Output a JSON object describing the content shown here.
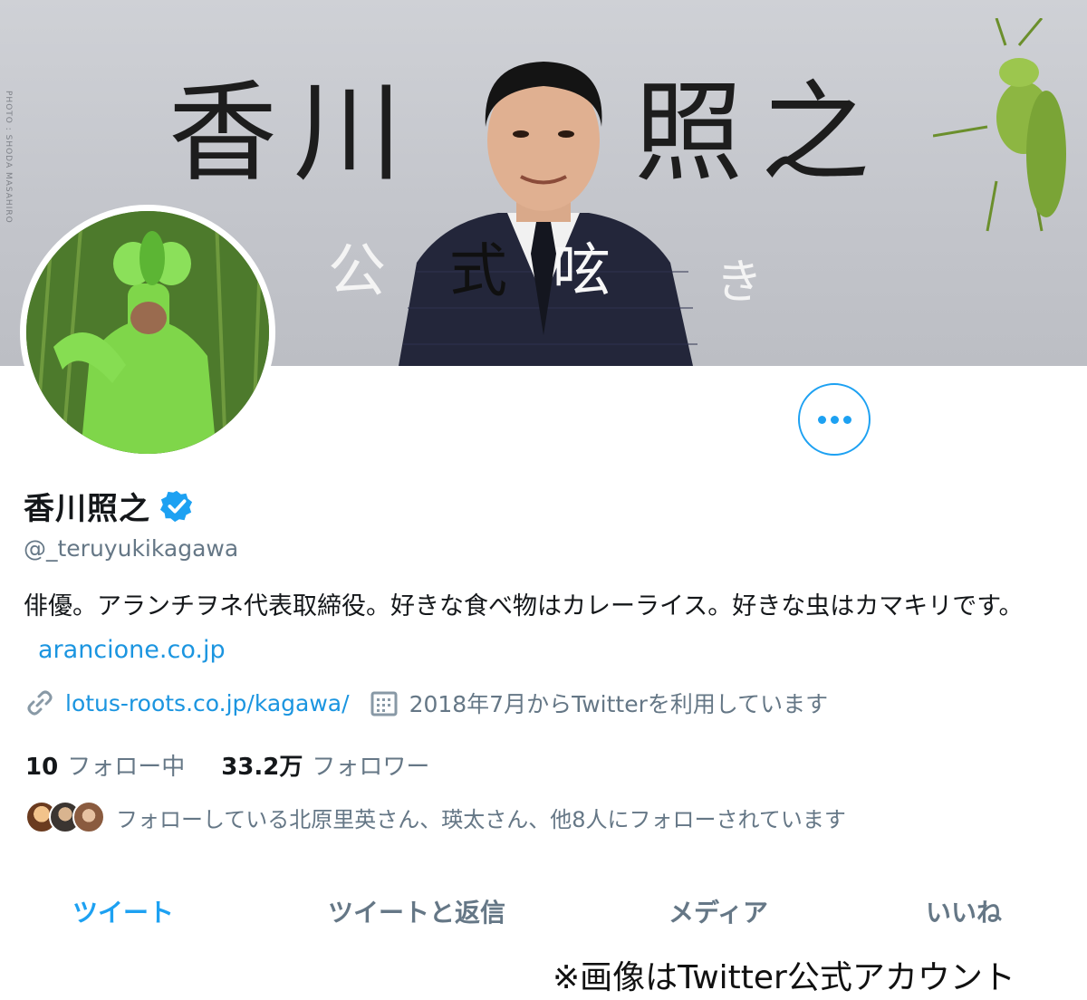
{
  "banner": {
    "photo_credit": "PHOTO : SHODA MASAHIRO",
    "title_left": "香川",
    "title_right": "照之",
    "subtitle": [
      "公",
      "式",
      "呟",
      "き"
    ]
  },
  "profile": {
    "display_name": "香川照之",
    "verified": true,
    "handle": "@_teruyukikagawa",
    "bio_text": "俳優。アランチヲネ代表取締役。好きな食べ物はカレーライス。好きな虫はカマキリです。",
    "bio_link": "arancione.co.jp",
    "website": "lotus-roots.co.jp/kagawa/",
    "joined": "2018年7月からTwitterを利用しています",
    "following_count": "10",
    "following_label": "フォロー中",
    "followers_count": "33.2万",
    "followers_label": "フォロワー",
    "followers_you_know": "フォローしている北原里英さん、瑛太さん、他8人にフォローされています"
  },
  "tabs": [
    {
      "label": "ツイート",
      "active": true
    },
    {
      "label": "ツイートと返信",
      "active": false
    },
    {
      "label": "メディア",
      "active": false
    },
    {
      "label": "いいね",
      "active": false
    }
  ],
  "caption": "※画像はTwitter公式アカウント",
  "colors": {
    "accent": "#1da1f2",
    "link": "#1b95e0",
    "muted": "#657786",
    "text": "#14171a"
  },
  "icons": {
    "more": "more-horizontal-icon",
    "verified": "verified-badge-icon",
    "link": "link-icon",
    "calendar": "calendar-icon"
  }
}
